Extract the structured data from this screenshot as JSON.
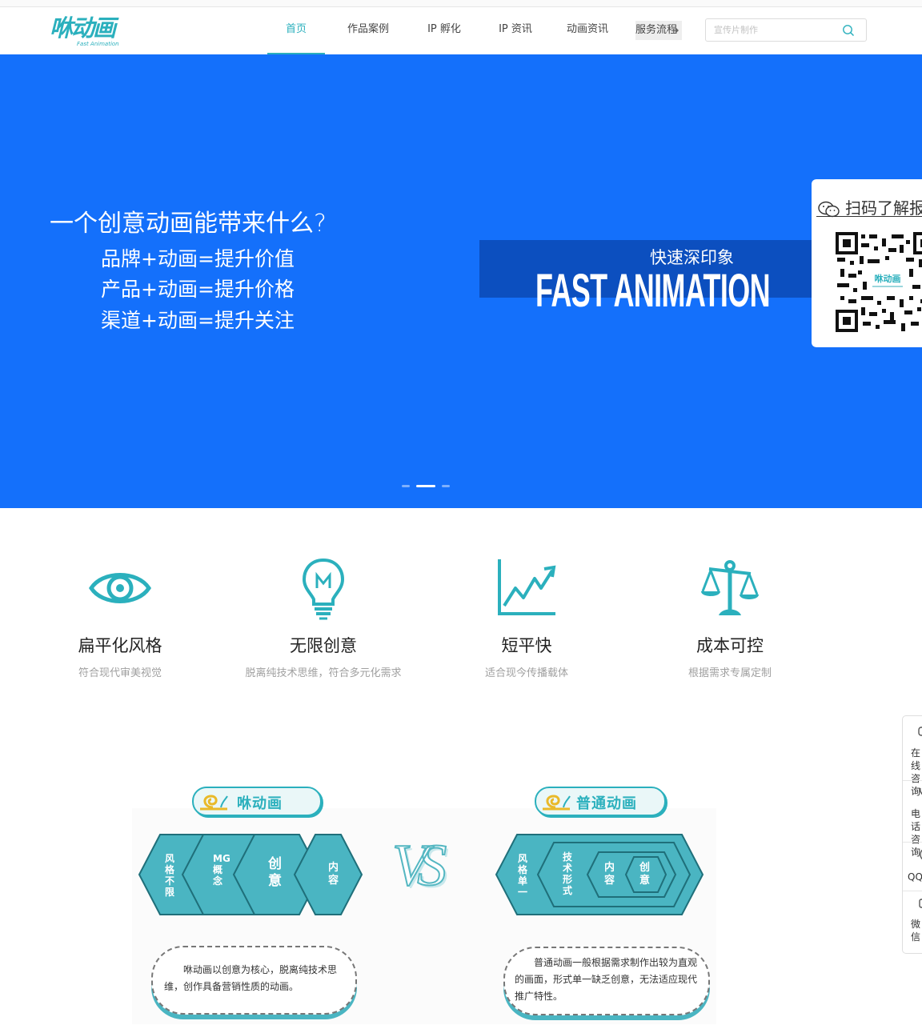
{
  "header": {
    "logo_text": "咻动画",
    "logo_sub": "Fast Animation",
    "nav": [
      {
        "label": "首页",
        "active": true
      },
      {
        "label": "作品案例"
      },
      {
        "label": "IP 孵化"
      },
      {
        "label": "IP 资讯"
      },
      {
        "label": "动画资讯"
      }
    ],
    "nav_more": "服务流程",
    "search_placeholder": "宣传片制作"
  },
  "banner": {
    "title": "一个创意动画能带来什么?",
    "lines": [
      "品牌+动画=提升价值",
      "产品+动画=提升价格",
      "渠道+动画=提升关注"
    ],
    "kicker": "快速深印象",
    "big": "FAST ANIMATION",
    "slides_total": 3,
    "slide_active": 2
  },
  "qr": {
    "caption": "扫码了解报价"
  },
  "features": [
    {
      "icon": "eye-icon",
      "title": "扁平化风格",
      "desc": "符合现代审美视觉"
    },
    {
      "icon": "lightbulb-icon",
      "title": "无限创意",
      "desc": "脱离纯技术思维，符合多元化需求"
    },
    {
      "icon": "growth-chart-icon",
      "title": "短平快",
      "desc": "适合现今传播载体"
    },
    {
      "icon": "scale-icon",
      "title": "成本可控",
      "desc": "根据需求专属定制"
    }
  ],
  "compare": {
    "left": {
      "title": "咻动画",
      "hexes": [
        "风格不限",
        "MG概念",
        "创意",
        "内容"
      ],
      "text": "咻动画以创意为核心，脱离纯技术思维，创作具备营销性质的动画。"
    },
    "vs": "VS",
    "right": {
      "title": "普通动画",
      "hexes": [
        "风格单一",
        "技术形式",
        "内容",
        "创意"
      ],
      "text": "普通动画一般根据需求制作出较为直观的画面，形式单一缺乏创意，无法适应现代推广特性。"
    },
    "colors": {
      "teal": "#2bb0bd",
      "hex_fill": "#4ab5c2",
      "hex_dark": "#1f6f7a"
    }
  },
  "float_bar": [
    {
      "icon": "chat-icon",
      "label": "在线咨询"
    },
    {
      "icon": "phone-icon",
      "label": "电话咨询"
    },
    {
      "icon": "qq-icon",
      "label": "QQ"
    },
    {
      "icon": "wechat-icon",
      "label": "微信"
    }
  ],
  "colors": {
    "brand": "#2bb0bd",
    "banner": "#1470fb",
    "banner_box": "#0c4fbf"
  }
}
